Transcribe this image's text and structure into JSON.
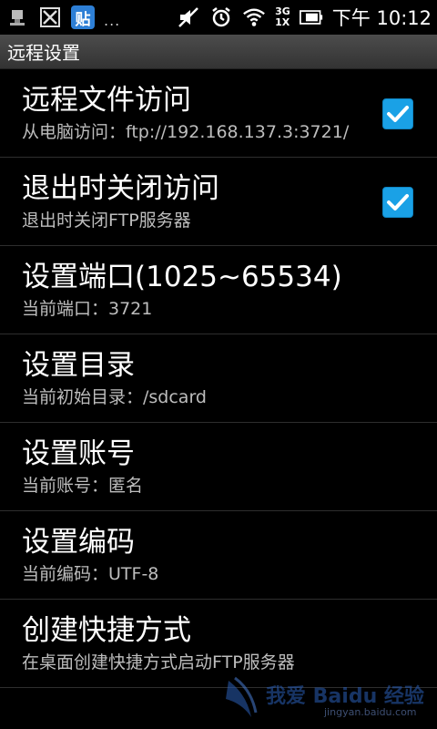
{
  "statusbar": {
    "notification_icons": [
      "usb-debug-icon",
      "x-icon",
      "tieba-icon"
    ],
    "tieba_label": "贴",
    "more": "...",
    "network_top": "3G",
    "network_bottom": "1X",
    "clock": "下午 10:12"
  },
  "titlebar": {
    "title": "远程设置"
  },
  "settings": [
    {
      "title": "远程文件访问",
      "subtitle": "从电脑访问：ftp://192.168.137.3:3721/",
      "checked": true
    },
    {
      "title": "退出时关闭访问",
      "subtitle": "退出时关闭FTP服务器",
      "checked": true
    },
    {
      "title": "设置端口(1025~65534)",
      "subtitle": "当前端口：3721"
    },
    {
      "title": "设置目录",
      "subtitle": "当前初始目录：/sdcard"
    },
    {
      "title": "设置账号",
      "subtitle": "当前账号：匿名"
    },
    {
      "title": "设置编码",
      "subtitle": "当前编码：UTF-8"
    },
    {
      "title": "创建快捷方式",
      "subtitle": "在桌面创建快捷方式启动FTP服务器"
    }
  ],
  "watermark": {
    "text": "我爱 Baidu 经验",
    "url": "jingyan.baidu.com"
  },
  "colors": {
    "checkbox": "#1aa1e6",
    "tieba": "#2d7fd6"
  }
}
